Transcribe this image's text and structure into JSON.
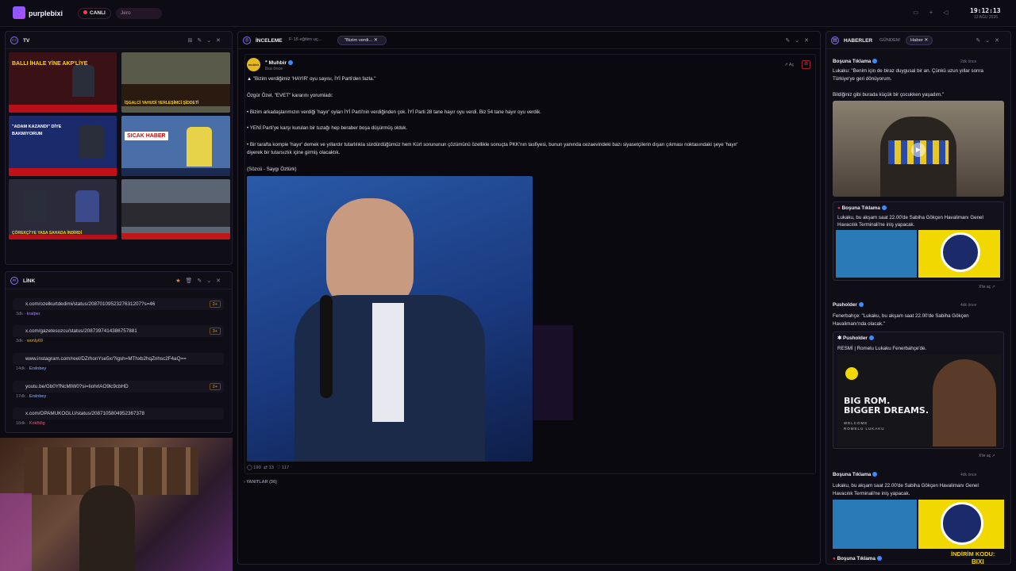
{
  "topbar": {
    "brand": "purplebixi",
    "live": "CANLI",
    "user": "Jero",
    "time": "19:12:13",
    "date": "12 AĞU 2026"
  },
  "tv": {
    "title": "TV",
    "tiles": [
      {
        "text": "BALLI İHALE YİNE AKP'LİYE"
      },
      {
        "text": "İŞGALCİ YAHUDİ YERLEŞİMCİ ŞİDDETİ"
      },
      {
        "text": "\"ADAM KAZANDI\" DİYE BAKMIYORUM"
      },
      {
        "text": "SICAK HABER"
      },
      {
        "text": "ÇÖREKÇİ'YE YASA SAHADA İNDİRDİ"
      },
      {
        "text": ""
      }
    ]
  },
  "link": {
    "title": "LİNK",
    "items": [
      {
        "url": "x.com/ozelkurtdedimi/status/2087010952327631207?s=46",
        "age": "3dk",
        "user": "kralper",
        "count": "2+"
      },
      {
        "url": "x.com/gazetesozcu/status/2087397414386757881",
        "age": "3dk",
        "user": "wonly69",
        "count": "3+"
      },
      {
        "url": "www.instagram.com/reel/DZrhonYse5x/?igsh=MThxb2hqZnhsc2F4aQ==",
        "age": "14dk",
        "user": "Erslnbey",
        "count": ""
      },
      {
        "url": "youtu.be/Gb0YfNcMIW0?si=IiohrlAO9lc9cbHD",
        "age": "17dk",
        "user": "Erslnbey",
        "count": "2+"
      },
      {
        "url": "x.com/OPAMUKOGLU/status/2087105804952367378",
        "age": "18dk",
        "user": "KokBilig",
        "count": ""
      }
    ]
  },
  "center": {
    "title": "İNCELEME",
    "tab1": "F-16 eğitim uç...",
    "tab2": "\"Bizim verdi...",
    "author": "Muhbir",
    "time": "8sa önce",
    "open": "Aç",
    "lines": [
      "▲ \"Bizim verdiğimiz 'HAYIR' oyu sayısı, İYİ Parti'den fazla.\"",
      "Özgür Özel, \"EVET\" kararını yorumladı:",
      "• Bizim arkadaşlarımızın verdiği 'hayır' oyları İYİ Parti'nin verdiğinden çok. İYİ Parti 28 tane hayır oyu verdi. Biz 54 tane hayır oyu verdik.",
      "• YENİ Parti'ye karşı kurulan bir tuzağı hep beraber boşa düşürmüş olduk.",
      "• Bir tarafta komple 'hayır' demek ve yıllardır tutarlılıkla sürdürdüğümüz hem Kürt sorununun çözümünü özellikle sonuçta PKK'nın tasfiyesi, bunun yanında cezaevindeki bazı siyasetçilerin dışarı çıkması noktasındaki şeye 'hayır'",
      "diyerek bir tutarsızlık içine girmiş olacaktık.",
      "(Sözcü - Saygı Öztürk)"
    ],
    "stats": {
      "replies": "190",
      "reposts": "13",
      "likes": "117"
    },
    "answers": "YANITLAR (36)"
  },
  "news": {
    "title": "HABERLER",
    "tab1": "GÜNDEM",
    "tab2": "Haber",
    "item1": {
      "src": "Boşuna Tıklama",
      "ago": "2dk önce",
      "l1": "Lukaku: \"Benim için de biraz duygusal bir an. Çünkü uzun yıllar sonra",
      "l2": "Türkiye'ye geri dönüyorum.",
      "l3": "Bildiğiniz gibi burada küçük bir çocukken yaşadım.\""
    },
    "card1": {
      "src": "Boşuna Tıklama",
      "text": "Lukaku, bu akşam saat 22.00'de Sabiha Gökçen Havalimanı Genel Havacılık Terminali'ne iniş yapacak."
    },
    "xte": "X'te aç",
    "item2": {
      "src": "Pusholder",
      "ago": "4dk önce",
      "l1": "Fenerbahçe: \"Lukaku, bu akşam saat 22.00'de Sabiha Gökçen",
      "l2": "Havalimanı'nda olacak.\""
    },
    "card2": {
      "src": "Pusholder",
      "text": "RESMİ | Romelu Lukaku Fenerbahçe'de.",
      "promo1": "BIG ROM.",
      "promo2": "BIGGER DREAMS.",
      "promo3": "WELCOME",
      "promo4": "ROMELU LUKAKU"
    },
    "item3": {
      "src": "Boşuna Tıklama",
      "ago": "4dk önce",
      "l1": "Lukaku, bu akşam saat 22.00'de Sabiha Gökçen Havalimanı Genel",
      "l2": "Havacılık Terminali'ne iniş yapacak."
    },
    "item4": {
      "src": "Boşuna Tıklama"
    }
  },
  "overlay": {
    "promo": "İNDİRİM KODU:",
    "code": "BIXI"
  }
}
